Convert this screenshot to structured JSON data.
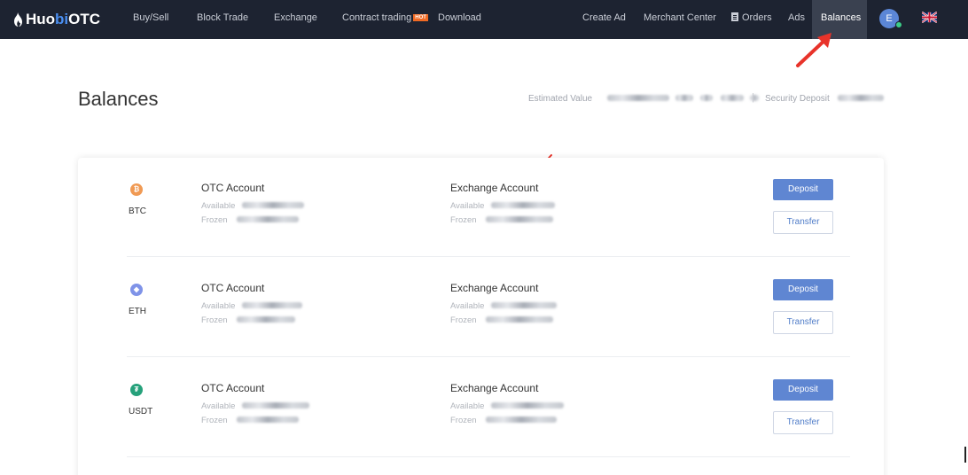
{
  "nav": {
    "logo_a": "Huo",
    "logo_b": "bi",
    "logo_c": " OTC",
    "left_items": [
      "Buy/Sell",
      "Block Trade",
      "Exchange",
      "Contract trading",
      "Download"
    ],
    "hot_badge": "HOT",
    "right_items": [
      "Create Ad",
      "Merchant Center",
      "Orders",
      "Ads"
    ],
    "active_item": "Balances",
    "avatar_letter": "E"
  },
  "header": {
    "title": "Balances",
    "estimated_label": "Estimated Value",
    "separator": "|",
    "security_label": "Security Deposit"
  },
  "accounts": [
    {
      "coin": "BTC",
      "icon_glyph": "₿",
      "icon_color": "#f09a54",
      "otc_title": "OTC Account",
      "exchange_title": "Exchange Account",
      "available_label": "Available",
      "frozen_label": "Frozen",
      "deposit_label": "Deposit",
      "transfer_label": "Transfer"
    },
    {
      "coin": "ETH",
      "icon_glyph": "◆",
      "icon_color": "#7f93e8",
      "otc_title": "OTC Account",
      "exchange_title": "Exchange Account",
      "available_label": "Available",
      "frozen_label": "Frozen",
      "deposit_label": "Deposit",
      "transfer_label": "Transfer"
    },
    {
      "coin": "USDT",
      "icon_glyph": "₮",
      "icon_color": "#26a17b",
      "otc_title": "OTC Account",
      "exchange_title": "Exchange Account",
      "available_label": "Available",
      "frozen_label": "Frozen",
      "deposit_label": "Deposit",
      "transfer_label": "Transfer"
    }
  ],
  "colors": {
    "nav_bg": "#1d2331",
    "accent": "#5f86d2",
    "arrow": "#e8332a"
  }
}
